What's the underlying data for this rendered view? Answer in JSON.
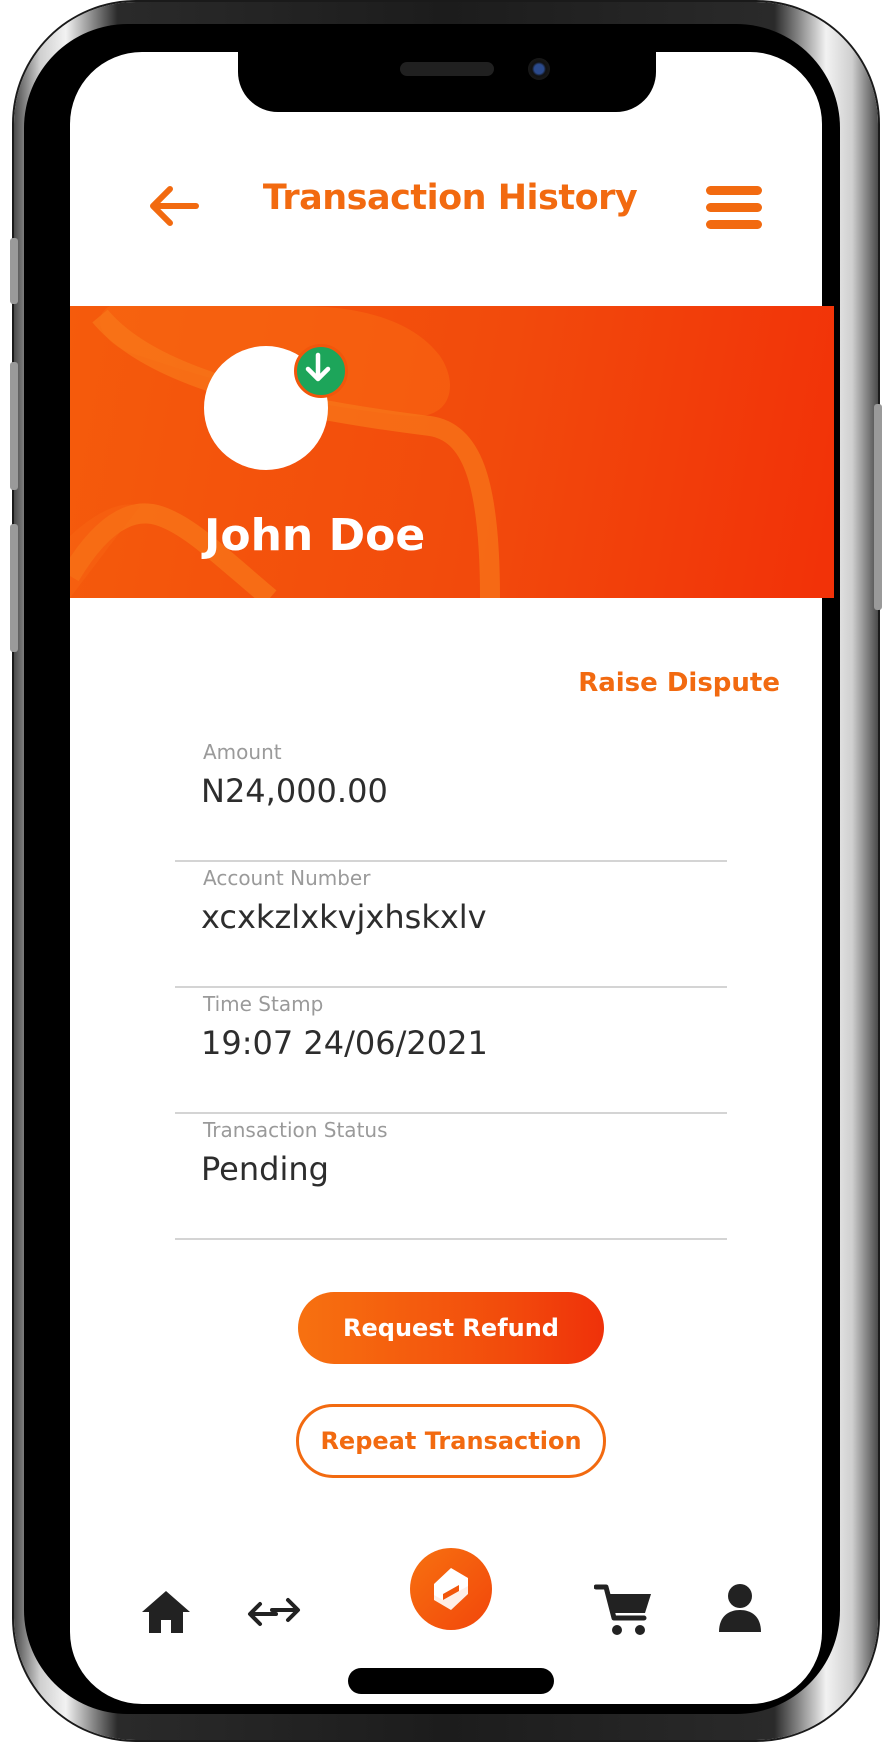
{
  "header": {
    "title": "Transaction History"
  },
  "profile": {
    "name": "John Doe"
  },
  "actions": {
    "raise_dispute": "Raise Dispute"
  },
  "details": [
    {
      "label": "Amount",
      "value": "N24,000.00"
    },
    {
      "label": "Account Number",
      "value": "xcxkzlxkvjxhskxlv"
    },
    {
      "label": "Time Stamp",
      "value": "19:07  24/06/2021"
    },
    {
      "label": "Transaction Status",
      "value": "Pending"
    }
  ],
  "buttons": {
    "request_refund": "Request Refund",
    "repeat_transaction": "Repeat Transaction"
  },
  "bottom_nav": [
    "home-icon",
    "transfer-icon",
    "app-logo-icon",
    "cart-icon",
    "profile-icon"
  ],
  "colors": {
    "accent": "#f26a10",
    "banner": "#f24a0c",
    "badge": "#1da55a"
  }
}
